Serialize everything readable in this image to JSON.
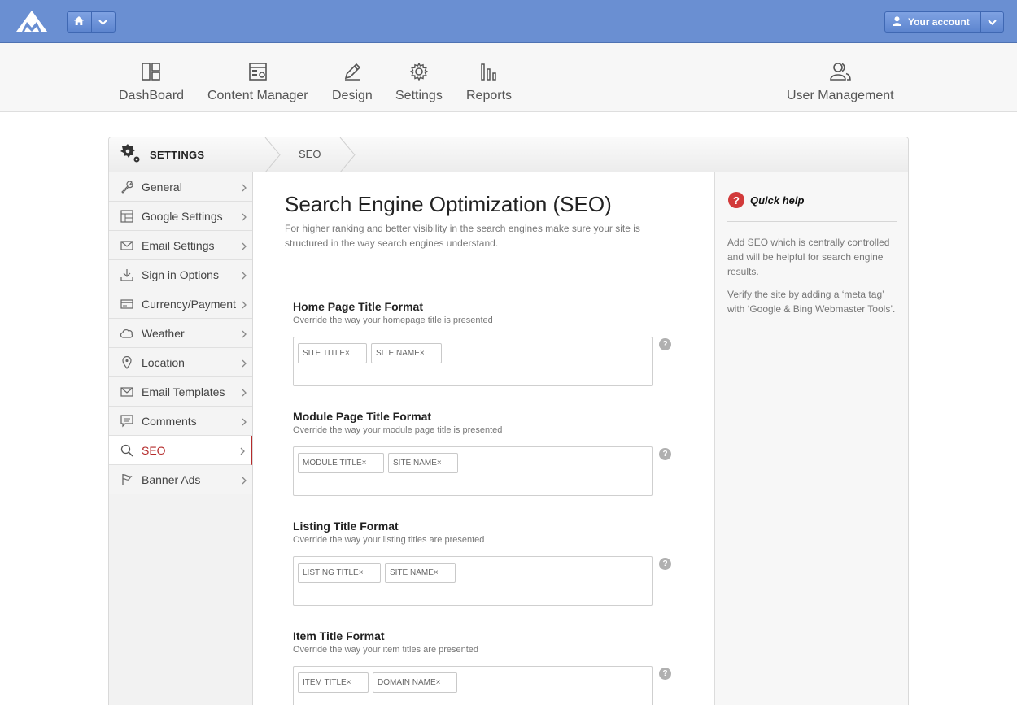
{
  "topbar": {
    "account_label": "Your account",
    "icons": {
      "logo": "brand-logo",
      "home": "home-icon",
      "caret": "chevron-down-icon",
      "user": "user-icon"
    },
    "bg_color": "#6a8fd2"
  },
  "nav": {
    "items": [
      {
        "label": "DashBoard",
        "icon": "dashboard-icon"
      },
      {
        "label": "Content Manager",
        "icon": "content-icon"
      },
      {
        "label": "Design",
        "icon": "pencil-icon"
      },
      {
        "label": "Settings",
        "icon": "gear-icon"
      },
      {
        "label": "Reports",
        "icon": "bar-chart-icon"
      },
      {
        "label": "User Management",
        "icon": "users-icon"
      }
    ]
  },
  "breadcrumb": {
    "section": "SETTINGS",
    "page": "SEO"
  },
  "sidebar": {
    "items": [
      {
        "label": "General",
        "icon": "wrench-icon"
      },
      {
        "label": "Google Settings",
        "icon": "grid-icon"
      },
      {
        "label": "Email Settings",
        "icon": "envelope-icon"
      },
      {
        "label": "Sign in Options",
        "icon": "download-icon"
      },
      {
        "label": "Currency/Payment",
        "icon": "card-icon"
      },
      {
        "label": "Weather",
        "icon": "cloud-icon"
      },
      {
        "label": "Location",
        "icon": "pin-icon"
      },
      {
        "label": "Email Templates",
        "icon": "envelope-icon"
      },
      {
        "label": "Comments",
        "icon": "comment-icon"
      },
      {
        "label": "SEO",
        "icon": "search-icon",
        "active": true
      },
      {
        "label": "Banner Ads",
        "icon": "flag-icon"
      }
    ],
    "active_color": "#b52b2b"
  },
  "main": {
    "title": "Search Engine Optimization (SEO)",
    "description": "For higher ranking and better visibility in the search engines make sure your site is structured in the way search engines understand.",
    "fields": [
      {
        "label": "Home Page Title Format",
        "sub": "Override the way your homepage title is presented",
        "tags": [
          "SITE TITLE×",
          "SITE NAME×"
        ]
      },
      {
        "label": "Module Page Title Format",
        "sub": "Override the way your module page title is presented",
        "tags": [
          "MODULE TITLE×",
          "SITE NAME×"
        ]
      },
      {
        "label": "Listing Title Format",
        "sub": "Override the way your listing titles are presented",
        "tags": [
          "LISTING TITLE×",
          "SITE NAME×"
        ]
      },
      {
        "label": "Item Title Format",
        "sub": "Override the way your item titles are presented",
        "tags": [
          "ITEM TITLE×",
          "DOMAIN NAME×"
        ]
      }
    ],
    "help_glyph": "?"
  },
  "help": {
    "title": "Quick help",
    "badge": "?",
    "paragraphs": [
      "Add SEO which is centrally controlled and will be helpful for search engine results.",
      "Verify the site by adding a ‘meta tag’ with ‘Google & Bing Webmaster Tools’."
    ],
    "badge_color": "#d23a3a"
  }
}
